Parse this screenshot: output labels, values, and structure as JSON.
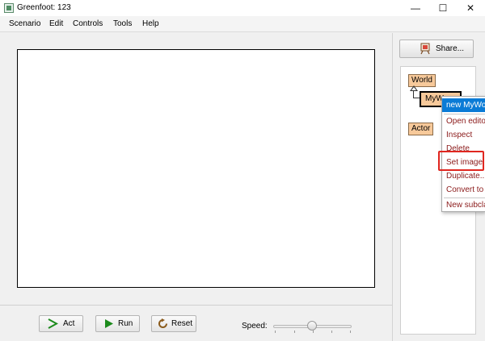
{
  "window": {
    "title": "Greenfoot: 123",
    "minimize_glyph": "—",
    "maximize_glyph": "☐",
    "close_glyph": "✕"
  },
  "menubar": {
    "items": [
      "Scenario",
      "Edit",
      "Controls",
      "Tools",
      "Help"
    ]
  },
  "controls": {
    "act_label": "Act",
    "run_label": "Run",
    "reset_label": "Reset",
    "act_icon": "act-arrow-icon",
    "run_icon": "run-play-icon",
    "reset_icon": "reset-refresh-icon",
    "speed_label": "Speed:",
    "speed_value_fraction": 0.48
  },
  "right_panel": {
    "share_label": "Share...",
    "share_icon": "share-easel-icon",
    "classes": {
      "world": "World",
      "myworld": "MyWo",
      "actor": "Actor"
    }
  },
  "context_menu": {
    "items": [
      "new MyWorld()",
      "Open editor",
      "Inspect",
      "Delete",
      "Set image...",
      "Duplicate...",
      "Convert to",
      "New subclass..."
    ],
    "active_index": 0,
    "highlighted_item": "Set image..."
  },
  "colors": {
    "class_fill": "#f7c99a",
    "menu_text": "#8b1a1a",
    "menu_active": "#0a7bd6",
    "highlight_border": "#e0261f",
    "act_icon": "#1b8a1b",
    "run_icon": "#1b8a1b",
    "reset_icon": "#8a5a1b"
  }
}
